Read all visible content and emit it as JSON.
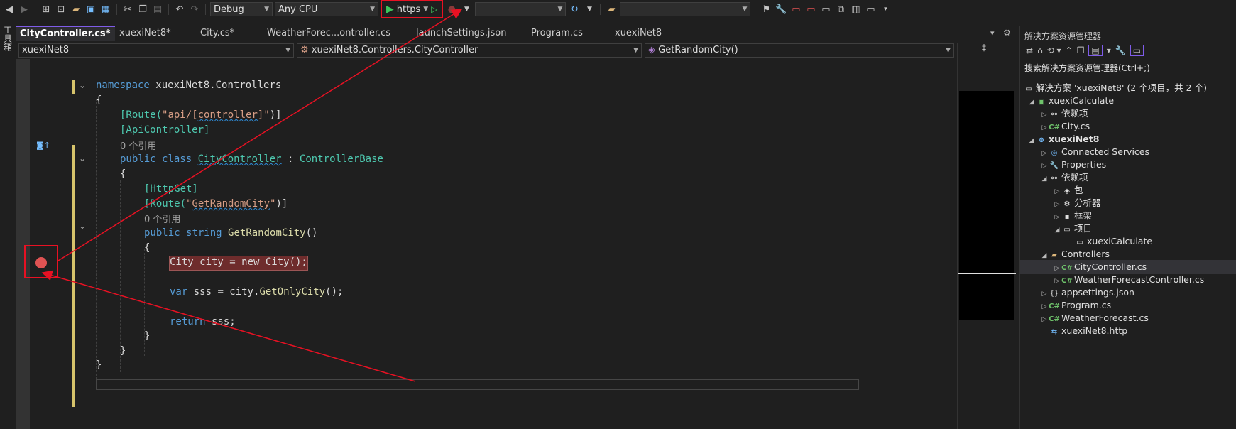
{
  "toolbar": {
    "config": "Debug",
    "platform": "Any CPU",
    "run_profile": "https",
    "startup_combo": "",
    "search_combo": ""
  },
  "left_tool": {
    "label": "工具箱"
  },
  "tabs": [
    {
      "label": "CityController.cs*",
      "active": true
    },
    {
      "label": "xuexiNet8*"
    },
    {
      "label": "City.cs*"
    },
    {
      "label": "WeatherForec...ontroller.cs"
    },
    {
      "label": "launchSettings.json"
    },
    {
      "label": "Program.cs"
    },
    {
      "label": "xuexiNet8"
    }
  ],
  "nav": {
    "project": "xuexiNet8",
    "type": "xuexiNet8.Controllers.CityController",
    "member": "GetRandomCity()"
  },
  "code": {
    "namespace_kw": "namespace",
    "namespace_name": "xuexiNet8.Controllers",
    "brace_open": "{",
    "brace_close": "}",
    "route_attr_pre": "[Route(",
    "route_attr_str1": "\"api/[",
    "route_attr_ctrl": "controller",
    "route_attr_str2": "]\"",
    "route_attr_post": ")]",
    "apicontroller": "[ApiController]",
    "refs1": "0 个引用",
    "class_public": "public",
    "class_kw": "class",
    "class_name": "CityController",
    "class_colon": " : ",
    "class_base": "ControllerBase",
    "httpget": "[HttpGet]",
    "route2_pre": "[Route(",
    "route2_q1": "\"",
    "route2_name": "GetRandomCity",
    "route2_q2": "\"",
    "route2_post": ")]",
    "refs2": "0 个引用",
    "m_public": "public",
    "m_string": "string",
    "m_name": "GetRandomCity",
    "m_paren": "()",
    "bp_line": "City city = new City();",
    "var_kw": "var",
    "var_rest1": " sss = city.",
    "var_method": "GetOnlyCity",
    "var_rest2": "();",
    "ret_kw": "return",
    "ret_rest": " sss;"
  },
  "solution": {
    "title": "解决方案资源管理器",
    "search_placeholder": "搜索解决方案资源管理器(Ctrl+;)",
    "items": [
      {
        "label": "解决方案 'xuexiNet8' (2 个项目，共 2 个)",
        "icon": "solution-icon"
      },
      {
        "label": "xuexiCalculate",
        "icon": "csproj-icon"
      },
      {
        "label": "依赖项",
        "icon": "dependencies-icon"
      },
      {
        "label": "City.cs",
        "icon": "cs-file-icon"
      },
      {
        "label": "xuexiNet8",
        "icon": "web-project-icon"
      },
      {
        "label": "Connected Services",
        "icon": "connected-services-icon"
      },
      {
        "label": "Properties",
        "icon": "properties-icon"
      },
      {
        "label": "依赖项",
        "icon": "dependencies-icon"
      },
      {
        "label": "包",
        "icon": "package-icon"
      },
      {
        "label": "分析器",
        "icon": "analyzer-icon"
      },
      {
        "label": "框架",
        "icon": "framework-icon"
      },
      {
        "label": "项目",
        "icon": "project-ref-icon"
      },
      {
        "label": "xuexiCalculate",
        "icon": "project-ref-icon"
      },
      {
        "label": "Controllers",
        "icon": "folder-icon"
      },
      {
        "label": "CityController.cs",
        "icon": "cs-file-icon"
      },
      {
        "label": "WeatherForecastController.cs",
        "icon": "cs-file-icon"
      },
      {
        "label": "appsettings.json",
        "icon": "json-file-icon"
      },
      {
        "label": "Program.cs",
        "icon": "cs-file-icon"
      },
      {
        "label": "WeatherForecast.cs",
        "icon": "cs-file-icon"
      },
      {
        "label": "xuexiNet8.http",
        "icon": "http-file-icon"
      }
    ]
  },
  "colors": {
    "annotation_red": "#e81123",
    "active_tab_accent": "#7f5ce9",
    "breakpoint": "#e05353"
  }
}
